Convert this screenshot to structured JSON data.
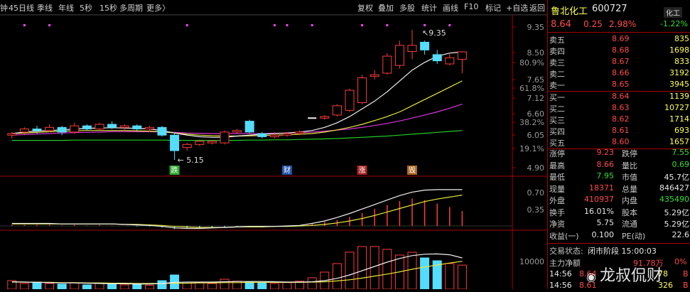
{
  "toolbar": {
    "left": [
      "钟",
      "45日线",
      "季线",
      "年线",
      "5秒",
      "15秒",
      "多周期",
      "更多〉"
    ],
    "right": [
      "复权",
      "叠加",
      "多股",
      "统计",
      "画线",
      "F10",
      "标记",
      "+自选",
      "返回"
    ]
  },
  "stock": {
    "name": "鲁北化工",
    "code": "600727",
    "price": "8.64",
    "change": "0.25",
    "pct": "2.98%",
    "sector": "化工",
    "sector_pct": "-1.22%"
  },
  "sells": [
    {
      "label": "卖五",
      "price": "8.69",
      "vol": "835"
    },
    {
      "label": "卖四",
      "price": "8.68",
      "vol": "1698"
    },
    {
      "label": "卖三",
      "price": "8.67",
      "vol": "833"
    },
    {
      "label": "卖二",
      "price": "8.66",
      "vol": "3192"
    },
    {
      "label": "卖一",
      "price": "8.65",
      "vol": "3945"
    }
  ],
  "buys": [
    {
      "label": "买一",
      "price": "8.64",
      "vol": "1139"
    },
    {
      "label": "买二",
      "price": "8.63",
      "vol": "10727"
    },
    {
      "label": "买三",
      "price": "8.62",
      "vol": "1714"
    },
    {
      "label": "买四",
      "price": "8.61",
      "vol": "693"
    },
    {
      "label": "买五",
      "price": "8.60",
      "vol": "1657"
    }
  ],
  "stats": [
    {
      "l1": "涨停",
      "v1": "9.23",
      "l2": "跌停",
      "v2": "7.55",
      "c1": "red",
      "c2": "green"
    },
    {
      "l1": "最高",
      "v1": "8.66",
      "l2": "量比",
      "v2": "0.69",
      "c1": "red",
      "c2": "green"
    },
    {
      "l1": "最低",
      "v1": "7.95",
      "l2": "市值",
      "v2": "45.7亿",
      "c1": "green",
      "c2": "white"
    },
    {
      "l1": "现量",
      "v1": "18371",
      "l2": "总量",
      "v2": "846427",
      "c1": "red",
      "c2": "white"
    },
    {
      "l1": "外盘",
      "v1": "410937",
      "l2": "内盘",
      "v2": "435490",
      "c1": "red",
      "c2": "green"
    },
    {
      "l1": "换手",
      "v1": "16.01%",
      "l2": "股本",
      "v2": "5.29亿",
      "c1": "white",
      "c2": "white"
    },
    {
      "l1": "净资",
      "v1": "5.75",
      "l2": "流通",
      "v2": "5.29亿",
      "c1": "white",
      "c2": "white"
    },
    {
      "l1": "收益(一)",
      "v1": "0.100",
      "l2": "PE(动)",
      "v2": "22.6",
      "c1": "white",
      "c2": "white"
    }
  ],
  "status": {
    "label": "交易状态:",
    "value": "闭市阶段 15:00:03"
  },
  "main_flow": {
    "label": "主力净额",
    "value": "91.78万",
    "pct": "0%"
  },
  "ticks": [
    {
      "time": "14:56",
      "price": "8.64",
      "vol": "78",
      "dir": "B"
    },
    {
      "time": "14:56",
      "price": "8.61",
      "vol": "326",
      "dir": "B"
    }
  ],
  "watermark": "龙叔侃财",
  "axis": {
    "price_ticks": [
      "9.35",
      "8.50",
      "80.9%",
      "7.65",
      "61.8%",
      "7.12",
      "6.60",
      "38.2%",
      "6.05",
      "19.1%",
      "4.90"
    ],
    "macd_ticks": [
      "0.70",
      "0.35"
    ],
    "vol_ticks": [
      "10000"
    ]
  },
  "chart_data": {
    "type": "candlestick",
    "high_label": "9.35",
    "low_label": "5.15",
    "markers": [
      "跌",
      "财",
      "涨",
      "毁"
    ],
    "candles": [
      {
        "o": 5.95,
        "c": 6.0,
        "h": 6.05,
        "l": 5.85
      },
      {
        "o": 6.05,
        "c": 6.15,
        "h": 6.2,
        "l": 5.95
      },
      {
        "o": 6.15,
        "c": 6.1,
        "h": 6.25,
        "l": 6.0
      },
      {
        "o": 6.1,
        "c": 6.2,
        "h": 6.3,
        "l": 6.05
      },
      {
        "o": 6.2,
        "c": 6.05,
        "h": 6.25,
        "l": 5.95
      },
      {
        "o": 6.05,
        "c": 6.25,
        "h": 6.35,
        "l": 6.0
      },
      {
        "o": 6.25,
        "c": 6.15,
        "h": 6.3,
        "l": 6.1
      },
      {
        "o": 6.15,
        "c": 6.3,
        "h": 6.35,
        "l": 6.1
      },
      {
        "o": 6.3,
        "c": 6.2,
        "h": 6.4,
        "l": 6.15
      },
      {
        "o": 6.2,
        "c": 6.25,
        "h": 6.3,
        "l": 6.1
      },
      {
        "o": 6.25,
        "c": 6.15,
        "h": 6.3,
        "l": 6.1
      },
      {
        "o": 6.15,
        "c": 6.2,
        "h": 6.25,
        "l": 6.05
      },
      {
        "o": 6.2,
        "c": 5.95,
        "h": 6.25,
        "l": 5.9
      },
      {
        "o": 5.95,
        "c": 5.45,
        "h": 6.0,
        "l": 5.15
      },
      {
        "o": 5.55,
        "c": 5.65,
        "h": 5.7,
        "l": 5.45
      },
      {
        "o": 5.65,
        "c": 5.75,
        "h": 5.8,
        "l": 5.6
      },
      {
        "o": 5.7,
        "c": 5.75,
        "h": 5.8,
        "l": 5.65
      },
      {
        "o": 5.7,
        "c": 6.05,
        "h": 6.1,
        "l": 5.65
      },
      {
        "o": 6.05,
        "c": 6.1,
        "h": 6.15,
        "l": 6.0
      },
      {
        "o": 6.4,
        "c": 6.05,
        "h": 6.45,
        "l": 6.0
      },
      {
        "o": 6.0,
        "c": 5.9,
        "h": 6.05,
        "l": 5.85
      },
      {
        "o": 5.9,
        "c": 5.95,
        "h": 6.05,
        "l": 5.85
      },
      {
        "o": 5.95,
        "c": 6.0,
        "h": 6.05,
        "l": 5.9
      },
      {
        "o": 6.0,
        "c": 6.05,
        "h": 6.1,
        "l": 5.95
      },
      {
        "o": 6.5,
        "c": 6.5,
        "h": 6.5,
        "l": 6.5
      },
      {
        "o": 6.5,
        "c": 6.55,
        "h": 6.6,
        "l": 6.45
      },
      {
        "o": 6.6,
        "c": 6.9,
        "h": 6.95,
        "l": 6.55
      },
      {
        "o": 6.75,
        "c": 7.4,
        "h": 7.45,
        "l": 6.7
      },
      {
        "o": 7.0,
        "c": 7.8,
        "h": 7.9,
        "l": 6.95
      },
      {
        "o": 7.85,
        "c": 7.9,
        "h": 8.05,
        "l": 7.75
      },
      {
        "o": 7.95,
        "c": 8.5,
        "h": 8.6,
        "l": 7.9
      },
      {
        "o": 8.2,
        "c": 8.85,
        "h": 9.0,
        "l": 8.1
      },
      {
        "o": 8.65,
        "c": 8.85,
        "h": 9.35,
        "l": 8.4
      },
      {
        "o": 8.95,
        "c": 8.7,
        "h": 9.0,
        "l": 8.55
      },
      {
        "o": 8.55,
        "c": 8.35,
        "h": 8.7,
        "l": 8.25
      },
      {
        "o": 8.25,
        "c": 8.45,
        "h": 8.6,
        "l": 8.2
      },
      {
        "o": 8.4,
        "c": 8.64,
        "h": 8.66,
        "l": 7.95
      }
    ],
    "ma_white": [
      6.0,
      6.05,
      6.08,
      6.1,
      6.12,
      6.15,
      6.17,
      6.18,
      6.19,
      6.18,
      6.17,
      6.15,
      6.1,
      6.02,
      5.95,
      5.9,
      5.88,
      5.88,
      5.92,
      5.95,
      5.98,
      6.0,
      6.02,
      6.05,
      6.1,
      6.2,
      6.35,
      6.55,
      6.8,
      7.05,
      7.35,
      7.7,
      8.05,
      8.3,
      8.5,
      8.6,
      8.64
    ],
    "ma_yellow": [
      6.0,
      6.02,
      6.04,
      6.06,
      6.08,
      6.09,
      6.1,
      6.1,
      6.1,
      6.1,
      6.09,
      6.08,
      6.06,
      6.02,
      5.98,
      5.95,
      5.93,
      5.92,
      5.92,
      5.93,
      5.94,
      5.95,
      5.96,
      5.98,
      6.0,
      6.05,
      6.12,
      6.2,
      6.3,
      6.42,
      6.55,
      6.7,
      6.9,
      7.1,
      7.3,
      7.5,
      7.7
    ],
    "ma_purple": [
      5.95,
      5.97,
      5.99,
      6.0,
      6.02,
      6.03,
      6.04,
      6.05,
      6.06,
      6.06,
      6.06,
      6.06,
      6.05,
      6.04,
      6.02,
      6.01,
      6.0,
      6.0,
      6.0,
      6.0,
      6.0,
      6.01,
      6.02,
      6.03,
      6.05,
      6.08,
      6.11,
      6.15,
      6.2,
      6.26,
      6.33,
      6.41,
      6.5,
      6.6,
      6.7,
      6.82,
      6.95
    ],
    "ma_green": [
      5.78,
      5.78,
      5.78,
      5.78,
      5.78,
      5.79,
      5.79,
      5.79,
      5.79,
      5.79,
      5.79,
      5.79,
      5.79,
      5.78,
      5.78,
      5.78,
      5.78,
      5.78,
      5.78,
      5.79,
      5.79,
      5.8,
      5.8,
      5.81,
      5.82,
      5.83,
      5.84,
      5.86,
      5.88,
      5.9,
      5.92,
      5.95,
      5.98,
      6.01,
      6.04,
      6.07,
      6.1
    ],
    "macd_bars": [
      0.02,
      0.02,
      0.02,
      0.02,
      0.01,
      0.02,
      0.01,
      0.02,
      0.01,
      0.0,
      -0.01,
      -0.01,
      -0.03,
      -0.06,
      -0.05,
      -0.05,
      -0.04,
      -0.02,
      -0.01,
      0.0,
      -0.01,
      -0.01,
      0.0,
      0.0,
      0.05,
      0.08,
      0.12,
      0.18,
      0.26,
      0.34,
      0.42,
      0.5,
      0.55,
      0.52,
      0.45,
      0.38,
      0.3
    ],
    "macd_dif": [
      0.05,
      0.05,
      0.05,
      0.05,
      0.04,
      0.04,
      0.04,
      0.04,
      0.04,
      0.03,
      0.02,
      0.01,
      -0.01,
      -0.04,
      -0.05,
      -0.05,
      -0.04,
      -0.03,
      -0.02,
      -0.01,
      -0.01,
      -0.01,
      0.0,
      0.01,
      0.05,
      0.1,
      0.17,
      0.25,
      0.34,
      0.43,
      0.52,
      0.61,
      0.68,
      0.72,
      0.73,
      0.73,
      0.73
    ],
    "macd_dea": [
      0.04,
      0.04,
      0.04,
      0.04,
      0.04,
      0.04,
      0.04,
      0.04,
      0.04,
      0.03,
      0.03,
      0.02,
      0.01,
      -0.01,
      -0.02,
      -0.03,
      -0.03,
      -0.03,
      -0.02,
      -0.02,
      -0.02,
      -0.01,
      -0.01,
      0.0,
      0.01,
      0.03,
      0.06,
      0.1,
      0.15,
      0.21,
      0.28,
      0.35,
      0.42,
      0.49,
      0.54,
      0.58,
      0.62
    ],
    "volumes": [
      3000,
      2000,
      2500,
      2000,
      1800,
      2200,
      1500,
      2000,
      1800,
      1500,
      1700,
      1400,
      3000,
      5000,
      2500,
      2200,
      2000,
      3500,
      2800,
      2500,
      2200,
      2000,
      2300,
      2800,
      4000,
      6000,
      9000,
      13000,
      15000,
      15000,
      14000,
      12000,
      13000,
      11000,
      10000,
      9000,
      8464
    ],
    "vol_ma1": [
      2600,
      2500,
      2400,
      2300,
      2200,
      2200,
      2100,
      2000,
      1900,
      1900,
      1800,
      1800,
      2000,
      2400,
      2500,
      2500,
      2500,
      2600,
      2700,
      2700,
      2700,
      2600,
      2500,
      2500,
      2600,
      3000,
      3800,
      5000,
      6500,
      8000,
      9500,
      10800,
      11800,
      12300,
      12400,
      12100,
      11000
    ],
    "vol_ma2": [
      2500,
      2500,
      2400,
      2400,
      2300,
      2300,
      2200,
      2200,
      2100,
      2100,
      2000,
      2000,
      2000,
      2100,
      2100,
      2200,
      2200,
      2300,
      2300,
      2400,
      2400,
      2400,
      2400,
      2400,
      2500,
      2600,
      2900,
      3300,
      3900,
      4600,
      5300,
      6100,
      7000,
      7800,
      8500,
      9200,
      9800
    ]
  }
}
